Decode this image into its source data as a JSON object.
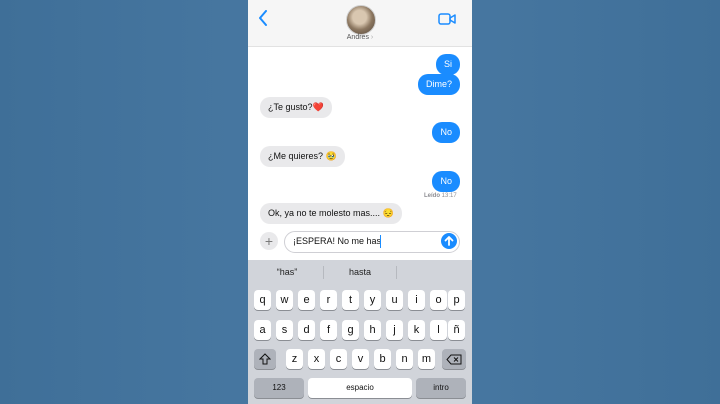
{
  "header": {
    "contact_name": "Andres",
    "back_icon": "chevron-left-icon",
    "video_icon": "video-camera-icon",
    "accent_color": "#1a8cff"
  },
  "messages": [
    {
      "side": "sent",
      "text": "Si"
    },
    {
      "side": "sent",
      "text": "Dime?"
    },
    {
      "side": "recv",
      "text": "¿Te gusto?❤️"
    },
    {
      "side": "sent",
      "text": "No"
    },
    {
      "side": "recv",
      "text": "¿Me quieres? 🥹"
    },
    {
      "side": "sent",
      "text": "No"
    },
    {
      "side": "recv",
      "text": "Ok, ya no te molesto mas.... 😔"
    }
  ],
  "read_receipt": {
    "label": "Leído",
    "time": "13:17"
  },
  "composer": {
    "text": "¡ESPERA! No me has",
    "plus_icon": "plus-icon",
    "send_icon": "arrow-up-icon"
  },
  "keyboard": {
    "suggestions": [
      "“has”",
      "hasta",
      ""
    ],
    "row1": [
      "q",
      "w",
      "e",
      "r",
      "t",
      "y",
      "u",
      "i",
      "o",
      "p"
    ],
    "row2": [
      "a",
      "s",
      "d",
      "f",
      "g",
      "h",
      "j",
      "k",
      "l",
      "ñ"
    ],
    "row3": [
      "z",
      "x",
      "c",
      "v",
      "b",
      "n",
      "m"
    ],
    "shift_icon": "shift-icon",
    "backspace_icon": "backspace-icon",
    "numbers_label": "123",
    "space_label": "espacio",
    "return_label": "intro"
  }
}
